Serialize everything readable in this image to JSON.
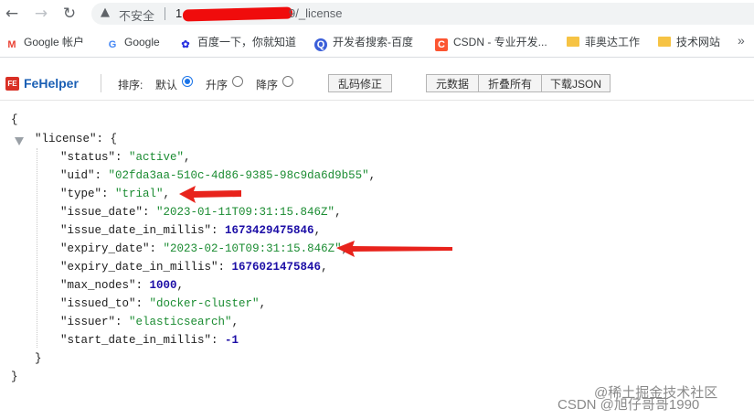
{
  "address_bar": {
    "back_icon": "←",
    "forward_icon": "→",
    "reload_icon": "↻",
    "warning_icon": "▲",
    "insecure_label": "不安全",
    "url_host": "1",
    "url_path": "9/_license"
  },
  "bookmarks": [
    {
      "label": "Google 帐户",
      "icon": "gmail-icon",
      "glyph": "M"
    },
    {
      "label": "Google",
      "icon": "google-icon",
      "glyph": "G"
    },
    {
      "label": "百度一下，你就知道",
      "icon": "baidu-paw-icon",
      "glyph": "✿"
    },
    {
      "label": "开发者搜索-百度",
      "icon": "dev-search-icon",
      "glyph": "Q"
    },
    {
      "label": "CSDN - 专业开发...",
      "icon": "csdn-icon",
      "glyph": "C"
    },
    {
      "label": "菲奥达工作",
      "icon": "folder-icon",
      "glyph": ""
    },
    {
      "label": "技术网站",
      "icon": "folder-icon",
      "glyph": ""
    }
  ],
  "bookmarks_more": "»",
  "fehelper": {
    "logo_text": "FE",
    "name": "FeHelper",
    "sort_label": "排序:",
    "sort_options": [
      "默认",
      "升序",
      "降序"
    ],
    "sort_selected": "默认",
    "fix_button": "乱码修正",
    "buttons": [
      "元数据",
      "折叠所有",
      "下载JSON"
    ]
  },
  "json_view": {
    "open_brace": "{",
    "license_key": "\"license\"",
    "license_open": "{",
    "close_inner": "}",
    "close_outer": "}",
    "fields": [
      {
        "key": "\"status\"",
        "value": "\"active\"",
        "type": "string"
      },
      {
        "key": "\"uid\"",
        "value": "\"02fda3aa-510c-4d86-9385-98c9da6d9b55\"",
        "type": "string"
      },
      {
        "key": "\"type\"",
        "value": "\"trial\"",
        "type": "string"
      },
      {
        "key": "\"issue_date\"",
        "value": "\"2023-01-11T09:31:15.846Z\"",
        "type": "string"
      },
      {
        "key": "\"issue_date_in_millis\"",
        "value": "1673429475846",
        "type": "number"
      },
      {
        "key": "\"expiry_date\"",
        "value": "\"2023-02-10T09:31:15.846Z\"",
        "type": "string"
      },
      {
        "key": "\"expiry_date_in_millis\"",
        "value": "1676021475846",
        "type": "number"
      },
      {
        "key": "\"max_nodes\"",
        "value": "1000",
        "type": "number"
      },
      {
        "key": "\"issued_to\"",
        "value": "\"docker-cluster\"",
        "type": "string"
      },
      {
        "key": "\"issuer\"",
        "value": "\"elasticsearch\"",
        "type": "string"
      },
      {
        "key": "\"start_date_in_millis\"",
        "value": "-1",
        "type": "number"
      }
    ]
  },
  "watermark": {
    "line1": "@稀土掘金技术社区",
    "line2": "CSDN @旭仔哥哥1990"
  },
  "colors": {
    "string_value": "#1b8c32",
    "number_value": "#1c0ea6",
    "annotation_arrow": "#e8231c",
    "fehelper_blue": "#1a5fb4"
  }
}
